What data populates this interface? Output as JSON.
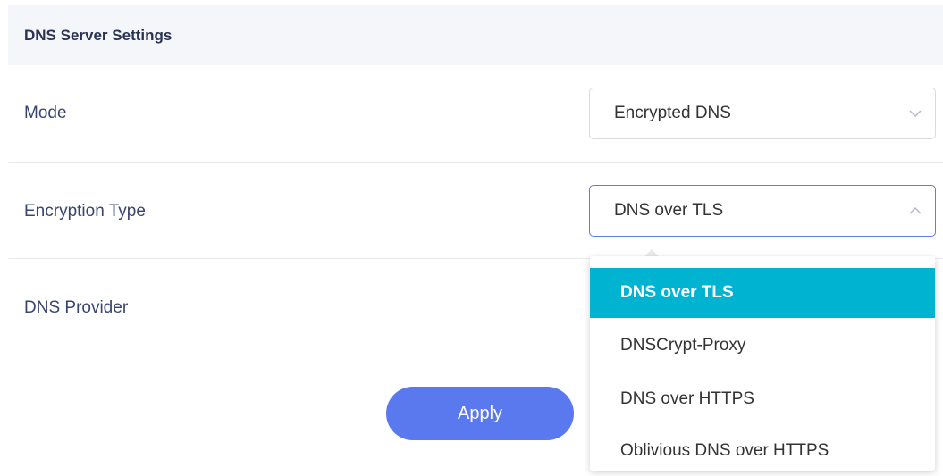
{
  "panel": {
    "title": "DNS Server Settings"
  },
  "rows": {
    "mode": {
      "label": "Mode",
      "value": "Encrypted DNS"
    },
    "encryption_type": {
      "label": "Encryption Type",
      "value": "DNS over TLS"
    },
    "dns_provider": {
      "label": "DNS Provider"
    }
  },
  "dropdown": {
    "options": [
      "DNS over TLS",
      "DNSCrypt-Proxy",
      "DNS over HTTPS",
      "Oblivious DNS over HTTPS"
    ],
    "selected": "DNS over TLS"
  },
  "apply_label": "Apply",
  "colors": {
    "accent": "#5b79ee",
    "selected": "#00b3d1"
  }
}
